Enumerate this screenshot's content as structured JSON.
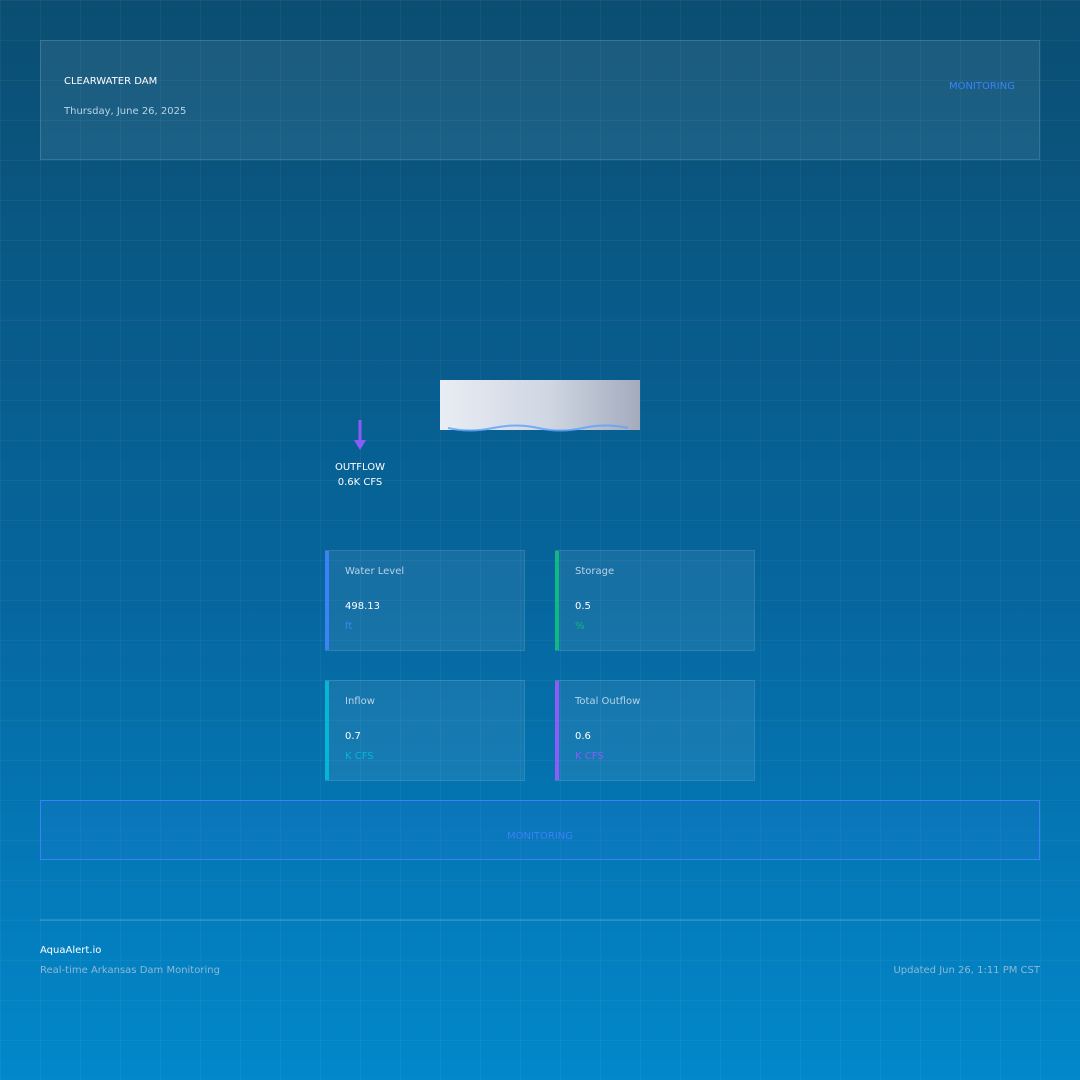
{
  "header": {
    "dam_name": "CLEARWATER DAM",
    "date": "Thursday, June 26, 2025",
    "status": "MONITORING"
  },
  "outflow_indicator": {
    "label": "OUTFLOW",
    "value": "0.6K CFS"
  },
  "metrics": [
    {
      "label": "Water Level",
      "value": "498.13",
      "unit": "ft",
      "color": "#3b82f6"
    },
    {
      "label": "Storage",
      "value": "0.5",
      "unit": "%",
      "color": "#10b981"
    },
    {
      "label": "Inflow",
      "value": "0.7",
      "unit": "K CFS",
      "color": "#06b6d4"
    },
    {
      "label": "Total Outflow",
      "value": "0.6",
      "unit": "K CFS",
      "color": "#8b5cf6"
    }
  ],
  "status_bar": {
    "text": "MONITORING",
    "color": "#3b82f6"
  },
  "footer": {
    "brand": "AquaAlert.io",
    "tagline": "Real-time Arkansas Dam Monitoring",
    "updated": "Updated Jun 26, 1:11 PM CST"
  },
  "colors": {
    "accent": "#3b82f6",
    "outflow_arrow": "#8b5cf6",
    "water": "#60a5fa"
  },
  "icons": {
    "outflow": "down-arrow-icon"
  }
}
